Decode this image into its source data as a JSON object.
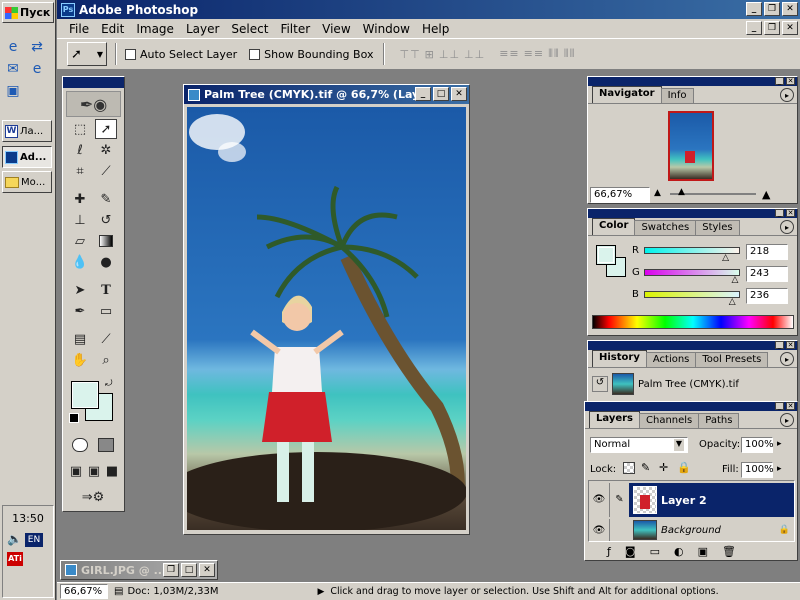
{
  "taskbar": {
    "start_label": "Пуск",
    "task_buttons": [
      {
        "label": "Ла...",
        "icon": "word-icon"
      },
      {
        "label": "Ad...",
        "icon": "photoshop-icon"
      },
      {
        "label": "Мо...",
        "icon": "folder-icon"
      }
    ],
    "clock": "13:50",
    "lang": "EN"
  },
  "app": {
    "title": "Adobe Photoshop",
    "menus": [
      "File",
      "Edit",
      "Image",
      "Layer",
      "Select",
      "Filter",
      "View",
      "Window",
      "Help"
    ]
  },
  "options_bar": {
    "auto_select_label": "Auto Select Layer",
    "bounding_box_label": "Show Bounding Box"
  },
  "documents": {
    "main": {
      "title": "Palm Tree (CMYK).tif @ 66,7% (Lay..."
    },
    "minimized": {
      "title": "GIRL.JPG @ ..."
    }
  },
  "navigator": {
    "tabs": [
      "Navigator",
      "Info"
    ],
    "zoom": "66,67%"
  },
  "color": {
    "tabs": [
      "Color",
      "Swatches",
      "Styles"
    ],
    "channels": [
      {
        "label": "R",
        "value": "218",
        "fraction": 0.855
      },
      {
        "label": "G",
        "value": "243",
        "fraction": 0.953
      },
      {
        "label": "B",
        "value": "236",
        "fraction": 0.925
      }
    ],
    "swatch_color": "#daf3ec"
  },
  "history": {
    "tabs": [
      "History",
      "Actions",
      "Tool Presets"
    ],
    "item": "Palm Tree (CMYK).tif"
  },
  "layers": {
    "tabs": [
      "Layers",
      "Channels",
      "Paths"
    ],
    "blend_mode": "Normal",
    "opacity_label": "Opacity:",
    "opacity_value": "100%",
    "lock_label": "Lock:",
    "fill_label": "Fill:",
    "fill_value": "100%",
    "items": [
      "Layer 2",
      "Background"
    ]
  },
  "status": {
    "zoom": "66,67%",
    "doc_info": "Doc: 1,03M/2,33M",
    "hint": "Click and drag to move layer or selection.  Use Shift and Alt for additional options."
  }
}
